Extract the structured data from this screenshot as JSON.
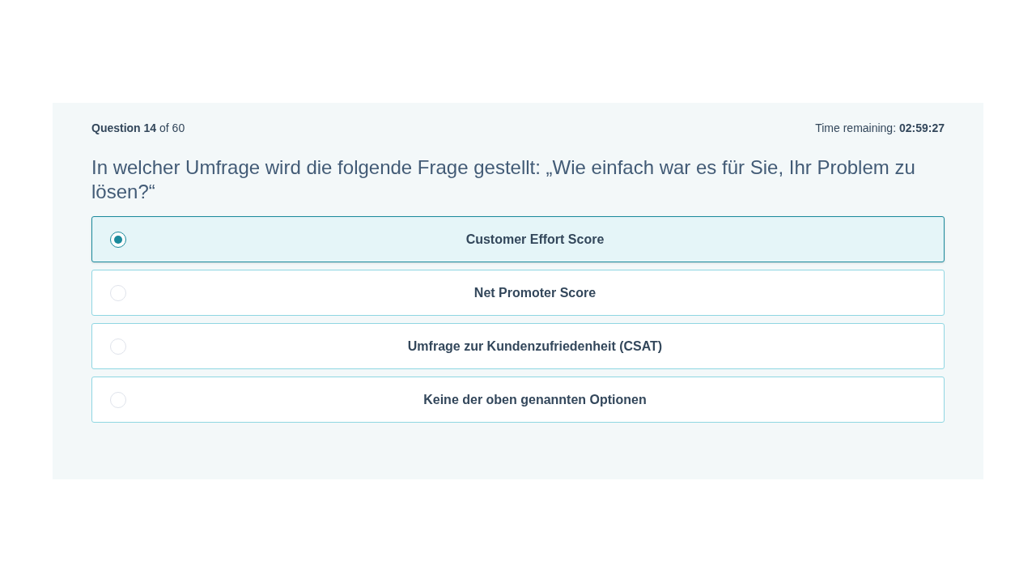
{
  "header": {
    "progress": "**Question 14** of 60",
    "timer": "Time remaining: **02:59:27**"
  },
  "question": "In welcher Umfrage wird die folgende Frage gestellt: „Wie einfach war es für Sie, Ihr Problem zu lösen?“",
  "options": [
    {
      "label": "Customer Effort Score",
      "selected": true
    },
    {
      "label": "Net Promoter Score",
      "selected": false
    },
    {
      "label": "Umfrage zur Kundenzufriedenheit (CSAT)",
      "selected": false
    },
    {
      "label": "Keine der oben genannten Optionen",
      "selected": false
    }
  ]
}
